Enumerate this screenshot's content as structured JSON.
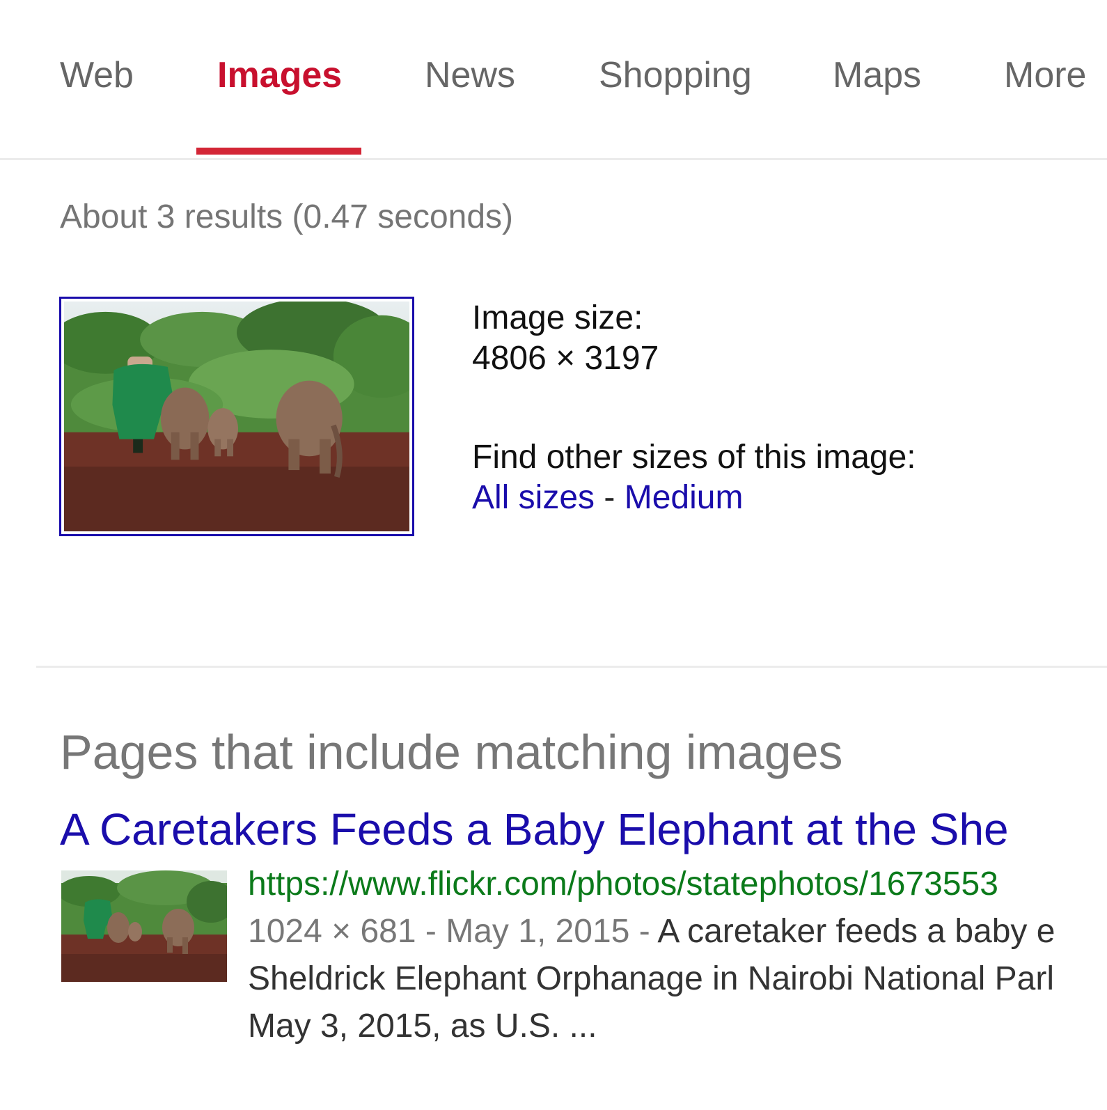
{
  "tabs": [
    {
      "label": "Web",
      "active": false
    },
    {
      "label": "Images",
      "active": true
    },
    {
      "label": "News",
      "active": false
    },
    {
      "label": "Shopping",
      "active": false
    },
    {
      "label": "Maps",
      "active": false
    },
    {
      "label": "More",
      "active": false
    }
  ],
  "result_stats": "About 3 results (0.47 seconds)",
  "image_info": {
    "size_label": "Image size:",
    "size_value": "4806 × 3197",
    "find_label": "Find other sizes of this image:",
    "all_sizes": "All sizes",
    "separator": "-",
    "medium": "Medium"
  },
  "pages_section": {
    "heading": "Pages that include matching images",
    "results": [
      {
        "title": "A Caretakers Feeds a Baby Elephant at the She",
        "url": "https://www.flickr.com/photos/statephotos/1673553",
        "meta": "1024 × 681 - May 1, 2015 - ",
        "snippet_1": "A caretaker feeds a baby e",
        "snippet_2": "Sheldrick Elephant Orphanage in Nairobi National Parl",
        "snippet_3": "May 3, 2015, as U.S. ..."
      }
    ]
  },
  "colors": {
    "active_tab": "#c8102e",
    "link": "#1a0dab",
    "url": "#0b7a1a",
    "muted": "#757575"
  }
}
